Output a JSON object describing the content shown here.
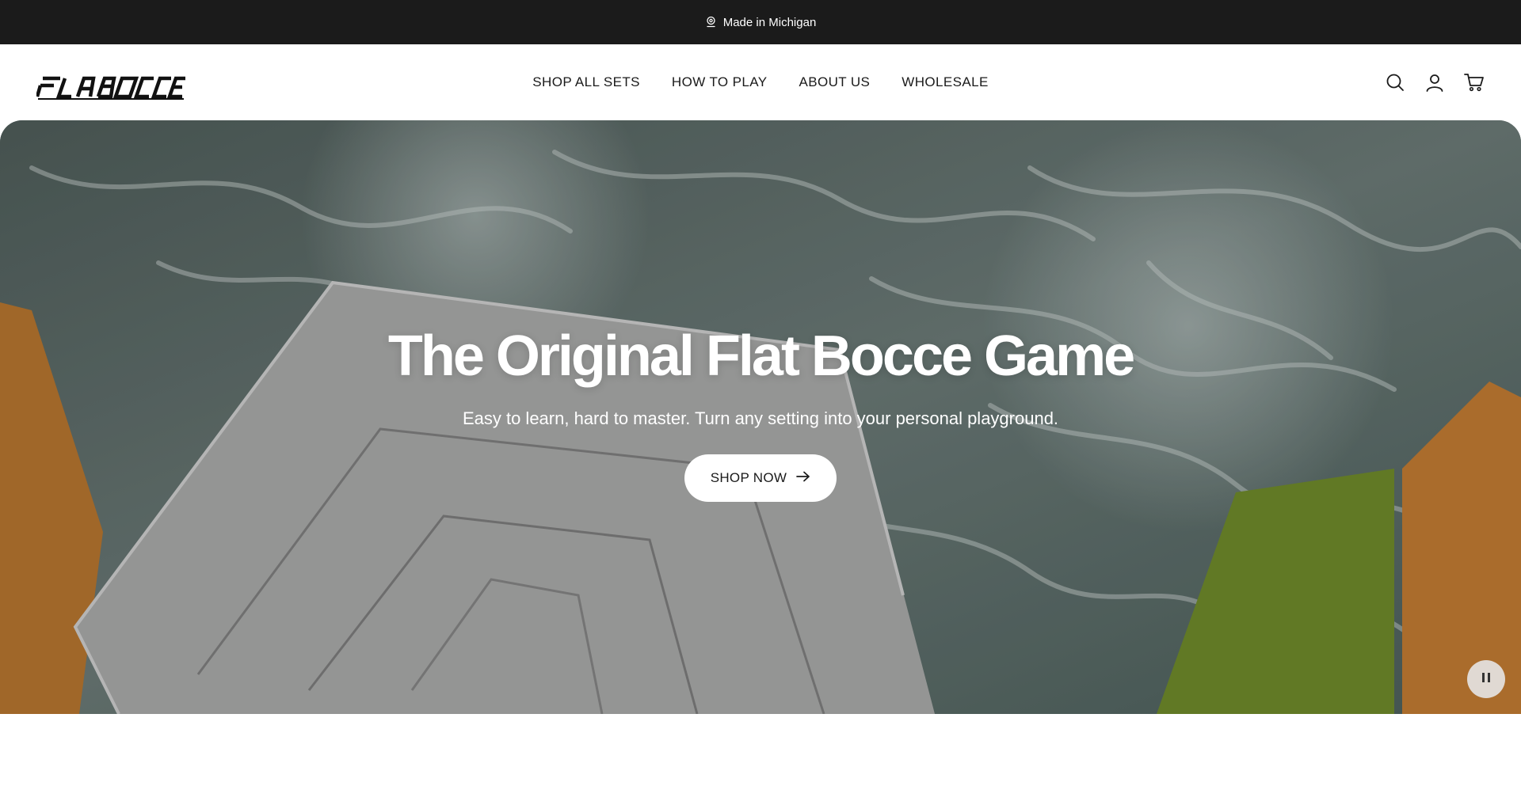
{
  "announcement": {
    "text": "Made in Michigan",
    "icon": "map-pin-icon"
  },
  "header": {
    "logo_text": "FLABOCCE",
    "nav": [
      {
        "label": "SHOP ALL SETS"
      },
      {
        "label": "HOW TO PLAY"
      },
      {
        "label": "ABOUT US"
      },
      {
        "label": "WHOLESALE"
      }
    ],
    "icons": [
      "search-icon",
      "account-icon",
      "cart-icon"
    ]
  },
  "hero": {
    "title": "The Original Flat Bocce Game",
    "subtitle": "Easy to learn, hard to master. Turn any setting into your personal playground.",
    "cta_label": "SHOP NOW",
    "pause_icon": "pause-icon"
  },
  "colors": {
    "announcement_bg": "#1b1b1b",
    "header_bg": "#ffffff",
    "text": "#1a1a1a",
    "water": "#5b6b68",
    "orange_piece": "#b7762f",
    "green_piece": "#6f8a2b"
  }
}
